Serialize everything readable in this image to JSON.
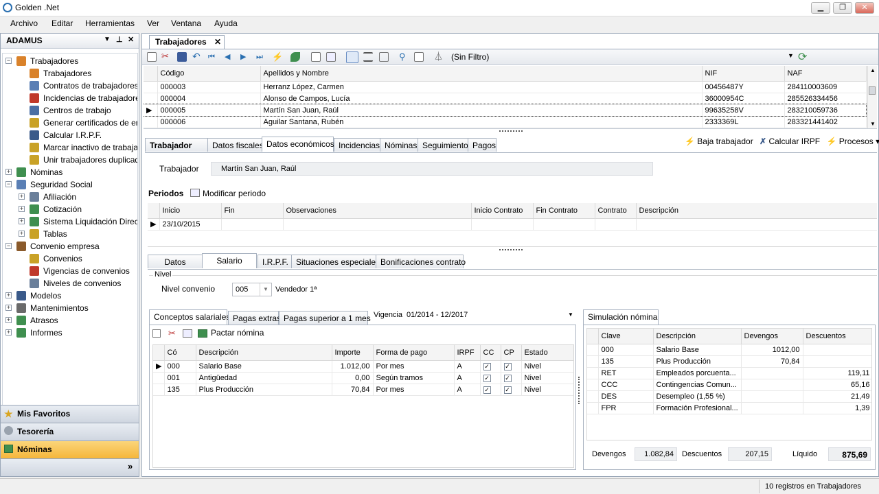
{
  "window": {
    "title": "Golden .Net",
    "min": "▁",
    "max": "❐",
    "close": "✕"
  },
  "menu": [
    "Archivo",
    "Editar",
    "Herramientas",
    "Ver",
    "Ventana",
    "Ayuda"
  ],
  "left_panel": {
    "title": "ADAMUS",
    "tree": [
      {
        "label": "Trabajadores",
        "level": 0,
        "expander": "−",
        "icon": "people-icon",
        "color": "#d9822b"
      },
      {
        "label": "Trabajadores",
        "level": 1,
        "icon": "person-icon",
        "color": "#d9822b"
      },
      {
        "label": "Contratos de trabajadores",
        "level": 1,
        "icon": "document-icon",
        "color": "#5a7fb5"
      },
      {
        "label": "Incidencias de trabajadores",
        "level": 1,
        "icon": "book-icon",
        "color": "#c0392b"
      },
      {
        "label": "Centros de trabajo",
        "level": 1,
        "icon": "building-icon",
        "color": "#4a6fa5"
      },
      {
        "label": "Generar certificados de empr",
        "level": 1,
        "icon": "wand-icon",
        "color": "#c9a227"
      },
      {
        "label": "Calcular I.R.P.F.",
        "level": 1,
        "icon": "calc-icon",
        "color": "#3a5a8a"
      },
      {
        "label": "Marcar inactivo de trabajado",
        "level": 1,
        "icon": "wand-icon",
        "color": "#c9a227"
      },
      {
        "label": "Unir trabajadores duplicados",
        "level": 1,
        "icon": "wand-icon",
        "color": "#c9a227"
      },
      {
        "label": "Nóminas",
        "level": 0,
        "expander": "+",
        "icon": "grid-icon",
        "color": "#3f8f4f"
      },
      {
        "label": "Seguridad Social",
        "level": 0,
        "expander": "−",
        "icon": "network-icon",
        "color": "#5a7fb5"
      },
      {
        "label": "Afiliación",
        "level": 1,
        "expander": "+",
        "icon": "card-icon",
        "color": "#6a7f9a"
      },
      {
        "label": "Cotización",
        "level": 1,
        "expander": "+",
        "icon": "table-icon",
        "color": "#3f8f4f"
      },
      {
        "label": "Sistema Liquidación Directa",
        "level": 1,
        "expander": "+",
        "icon": "table-icon",
        "color": "#3f8f4f"
      },
      {
        "label": "Tablas",
        "level": 1,
        "expander": "+",
        "icon": "table-icon",
        "color": "#c9a227"
      },
      {
        "label": "Convenio empresa",
        "level": 0,
        "expander": "−",
        "icon": "briefcase-icon",
        "color": "#8a5a2b"
      },
      {
        "label": "Convenios",
        "level": 1,
        "icon": "notebook-icon",
        "color": "#c9a227"
      },
      {
        "label": "Vigencias de convenios",
        "level": 1,
        "icon": "calendar-icon",
        "color": "#c0392b"
      },
      {
        "label": "Niveles de convenios",
        "level": 1,
        "icon": "list-icon",
        "color": "#6a7f9a"
      },
      {
        "label": "Modelos",
        "level": 0,
        "expander": "+",
        "icon": "calc-icon",
        "color": "#3a5a8a"
      },
      {
        "label": "Mantenimientos",
        "level": 0,
        "expander": "+",
        "icon": "tools-icon",
        "color": "#6a6a6a"
      },
      {
        "label": "Atrasos",
        "level": 0,
        "expander": "+",
        "icon": "grid-icon",
        "color": "#3f8f4f"
      },
      {
        "label": "Informes",
        "level": 0,
        "expander": "+",
        "icon": "leaf-icon",
        "color": "#3f8f4f"
      }
    ],
    "nav": [
      {
        "label": "Mis Favoritos",
        "icon": "star-icon",
        "active": false
      },
      {
        "label": "Tesorería",
        "icon": "bank-icon",
        "active": false
      },
      {
        "label": "Nóminas",
        "icon": "grid-icon",
        "active": true
      }
    ],
    "more": "»"
  },
  "doc_tab": {
    "label": "Trabajadores",
    "close": "✕"
  },
  "toolbar": {
    "filter": "(Sin Filtro)"
  },
  "workers_grid": {
    "columns": [
      "Código",
      "Apellidos y Nombre",
      "NIF",
      "NAF"
    ],
    "rows": [
      [
        "000003",
        "Herranz López, Carmen",
        "00456487Y",
        "284110003609"
      ],
      [
        "000004",
        "Alonso de Campos, Lucía",
        "36000954C",
        "285526334456"
      ],
      [
        "000005",
        "Martín San Juan, Raúl",
        "99635258V",
        "283210059736"
      ],
      [
        "000006",
        "Aguilar Santana, Rubén",
        "2333369L",
        "283321441402"
      ]
    ],
    "selected_row": 2
  },
  "detail_tabs": [
    "Trabajador",
    "Datos fiscales",
    "Datos económicos",
    "Incidencias",
    "Nóminas",
    "Seguimiento",
    "Pagos"
  ],
  "detail_active_tab": 2,
  "actions": {
    "baja": "Baja trabajador",
    "calcular": "Calcular IRPF",
    "procesos": "Procesos ▾"
  },
  "trabajador": {
    "label": "Trabajador",
    "value": "Martín San Juan, Raúl"
  },
  "periodos": {
    "title": "Periodos",
    "modify": "Modificar periodo",
    "columns": [
      "Inicio",
      "Fin",
      "Observaciones",
      "Inicio Contrato",
      "Fin Contrato",
      "Contrato",
      "Descripción"
    ],
    "rows": [
      [
        "23/10/2015",
        "",
        "",
        "",
        "",
        "",
        ""
      ]
    ]
  },
  "sub_tabs": [
    "Datos",
    "Salario",
    "I.R.P.F.",
    "Situaciones especiales",
    "Bonificaciones contrato"
  ],
  "sub_active_tab": 1,
  "nivel": {
    "group": "Nivel",
    "label": "Nivel convenio",
    "value": "005",
    "desc": "Vendedor 1ª"
  },
  "concepts": {
    "tabs": [
      "Conceptos salariales",
      "Pagas extras",
      "Pagas superior a 1 mes"
    ],
    "vigencia_label": "Vigencia",
    "vigencia_value": "01/2014 - 12/2017",
    "pactar": "Pactar nómina",
    "columns": [
      "Có",
      "Descripción",
      "Importe",
      "Forma de pago",
      "IRPF",
      "CC",
      "CP",
      "Estado"
    ],
    "rows": [
      [
        "000",
        "Salario Base",
        "1.012,00",
        "Por mes",
        "A",
        "✓",
        "✓",
        "Nivel"
      ],
      [
        "001",
        "Antigüedad",
        "0,00",
        "Según tramos",
        "A",
        "✓",
        "✓",
        "Nivel"
      ],
      [
        "135",
        "Plus Producción",
        "70,84",
        "Por mes",
        "A",
        "✓",
        "✓",
        "Nivel"
      ]
    ]
  },
  "simulacion": {
    "tab": "Simulación nómina",
    "columns": [
      "Clave",
      "Descripción",
      "Devengos",
      "Descuentos"
    ],
    "rows": [
      [
        "000",
        "Salario Base",
        "1012,00",
        ""
      ],
      [
        "135",
        "Plus Producción",
        "70,84",
        ""
      ],
      [
        "RET",
        "Empleados porcuenta...",
        "",
        "119,11"
      ],
      [
        "CCC",
        "Contingencias Comun...",
        "",
        "65,16"
      ],
      [
        "DES",
        "Desempleo (1,55 %)",
        "",
        "21,49"
      ],
      [
        "FPR",
        "Formación Profesional...",
        "",
        "1,39"
      ]
    ],
    "devengos_label": "Devengos",
    "devengos": "1.082,84",
    "descuentos_label": "Descuentos",
    "descuentos": "207,15",
    "liquido_label": "Líquido",
    "liquido": "875,69"
  },
  "status": "10 registros en Trabajadores"
}
